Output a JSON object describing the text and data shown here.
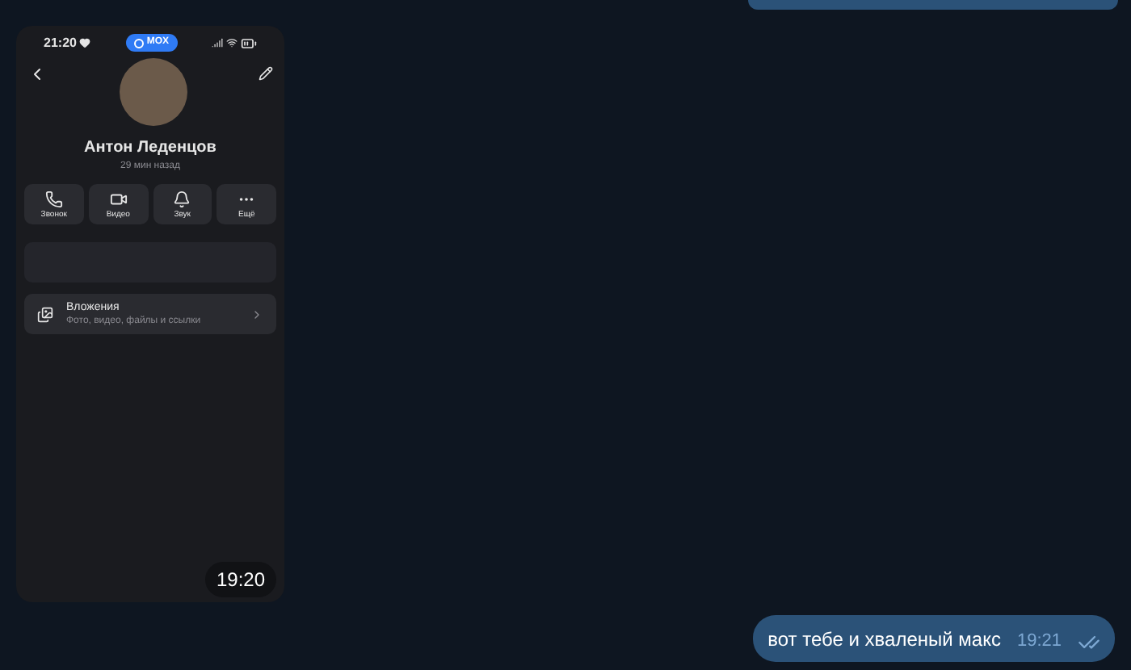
{
  "photo_message": {
    "status_bar": {
      "time": "21:20",
      "badge": "MOX"
    },
    "profile": {
      "name": "Антон Леденцов",
      "last_seen": "29 мин назад"
    },
    "actions": [
      {
        "kind": "call",
        "label": "Звонок"
      },
      {
        "kind": "video",
        "label": "Видео"
      },
      {
        "kind": "sound",
        "label": "Звук"
      },
      {
        "kind": "more",
        "label": "Ещё"
      }
    ],
    "attachments": {
      "title": "Вложения",
      "subtitle": "Фото, видео, файлы и ссылки"
    },
    "time": "19:20"
  },
  "text_message": {
    "text": "вот тебе и хваленый макс",
    "time": "19:21",
    "read": true
  }
}
